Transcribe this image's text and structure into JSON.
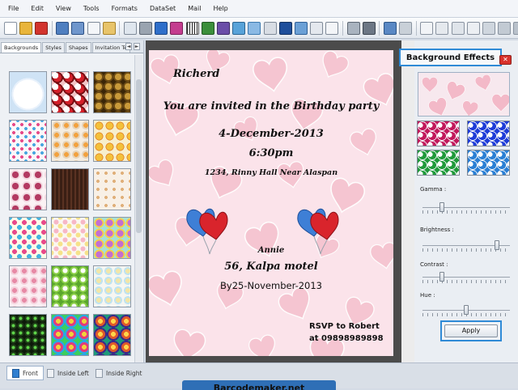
{
  "menu": [
    "File",
    "Edit",
    "View",
    "Tools",
    "Formats",
    "DataSet",
    "Mail",
    "Help"
  ],
  "left_panel": {
    "tabs": [
      "Backgrounds",
      "Styles",
      "Shapes",
      "Invitation Te"
    ],
    "scroll_left": "◄",
    "scroll_right": "►"
  },
  "card": {
    "line1": "Richerd",
    "line2": "You are invited in the Birthday party",
    "line3": "4-December-2013",
    "line4": "6:30pm",
    "line5": "1234, Rinny Hall Near Alaspan",
    "line6": "Annie",
    "line7": "56, Kalpa motel",
    "line8": "By25-November-2013",
    "rsvp1": "RSVP to Robert",
    "rsvp2": "at 09898989898"
  },
  "right_panel": {
    "title": "Background Effects",
    "close_label": "✕",
    "gamma_label": "Gamma :",
    "brightness_label": "Brightness :",
    "contrast_label": "Contrast :",
    "hue_label": "Hue :",
    "apply_label": "Apply",
    "gamma_level": 0.22,
    "brightness_level": 0.85,
    "contrast_level": 0.22,
    "hue_level": 0.5,
    "swatch_colors": [
      "#c2185b",
      "#1e3cd8",
      "#1f9a3a",
      "#2a7fd4"
    ]
  },
  "bottom_tabs": [
    "Front",
    "Inside Left",
    "Inside Right"
  ],
  "watermark": "Barcodemaker.net"
}
